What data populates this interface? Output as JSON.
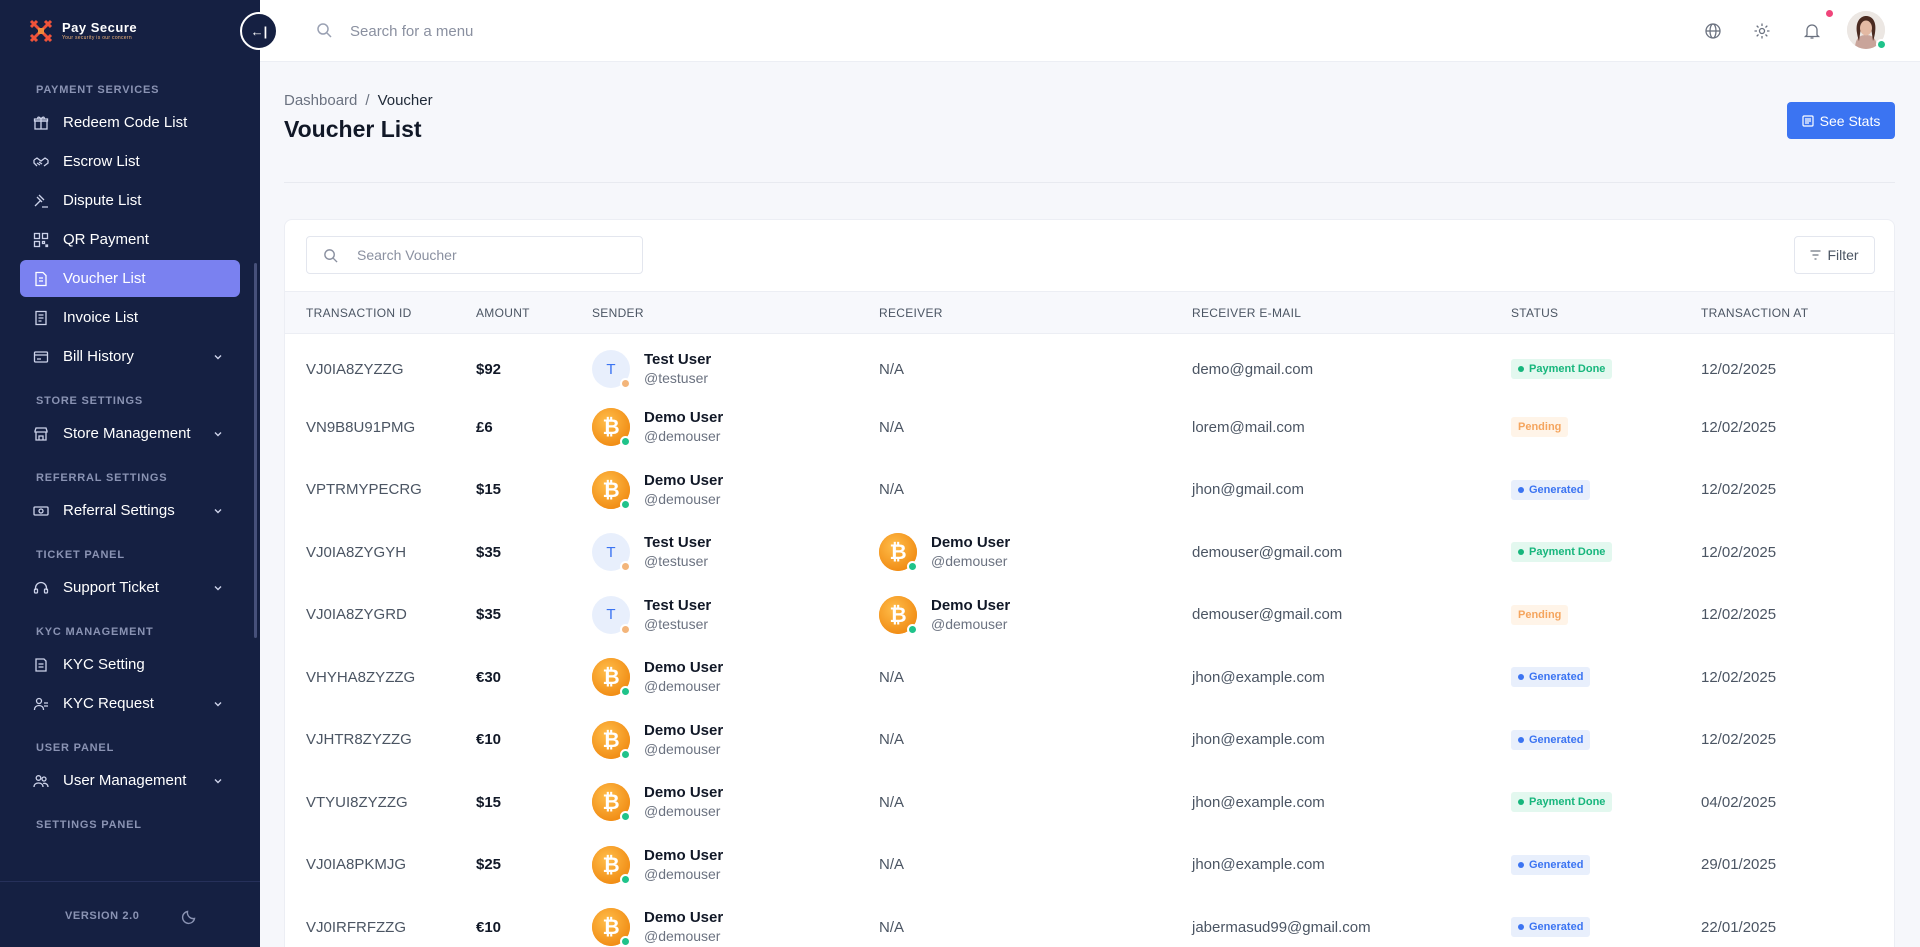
{
  "brand": {
    "name": "Pay Secure",
    "tagline": "Your security is our concern"
  },
  "sidebar": {
    "sections": [
      {
        "title": "PAYMENT SERVICES",
        "items": [
          {
            "label": "Redeem Code List",
            "icon": "gift-icon",
            "chevron": false,
            "active": false
          },
          {
            "label": "Escrow List",
            "icon": "handshake-icon",
            "chevron": false,
            "active": false
          },
          {
            "label": "Dispute List",
            "icon": "gavel-icon",
            "chevron": false,
            "active": false
          },
          {
            "label": "QR Payment",
            "icon": "qr-icon",
            "chevron": false,
            "active": false
          },
          {
            "label": "Voucher List",
            "icon": "voucher-icon",
            "chevron": false,
            "active": true
          },
          {
            "label": "Invoice List",
            "icon": "invoice-icon",
            "chevron": false,
            "active": false
          },
          {
            "label": "Bill History",
            "icon": "bill-icon",
            "chevron": true,
            "active": false
          }
        ]
      },
      {
        "title": "STORE SETTINGS",
        "items": [
          {
            "label": "Store Management",
            "icon": "store-icon",
            "chevron": true,
            "active": false
          }
        ]
      },
      {
        "title": "REFERRAL SETTINGS",
        "items": [
          {
            "label": "Referral Settings",
            "icon": "money-icon",
            "chevron": true,
            "active": false
          }
        ]
      },
      {
        "title": "TICKET PANEL",
        "items": [
          {
            "label": "Support Ticket",
            "icon": "headset-icon",
            "chevron": true,
            "active": false
          }
        ]
      },
      {
        "title": "KYC MANAGEMENT",
        "items": [
          {
            "label": "KYC Setting",
            "icon": "document-icon",
            "chevron": false,
            "active": false
          },
          {
            "label": "KYC Request",
            "icon": "user-check-icon",
            "chevron": true,
            "active": false
          }
        ]
      },
      {
        "title": "USER PANEL",
        "items": [
          {
            "label": "User Management",
            "icon": "users-icon",
            "chevron": true,
            "active": false
          }
        ]
      },
      {
        "title": "SETTINGS PANEL",
        "items": []
      }
    ],
    "version": "VERSION 2.0"
  },
  "topbar": {
    "search_placeholder": "Search for a menu"
  },
  "page": {
    "breadcrumb": {
      "root": "Dashboard",
      "separator": "/",
      "current": "Voucher"
    },
    "title": "Voucher List",
    "stats_button": "See Stats"
  },
  "table": {
    "search_placeholder": "Search Voucher",
    "filter_label": "Filter",
    "columns": [
      "TRANSACTION ID",
      "AMOUNT",
      "SENDER",
      "RECEIVER",
      "RECEIVER E-MAIL",
      "STATUS",
      "TRANSACTION AT"
    ],
    "rows": [
      {
        "id": "VJ0IA8ZYZZG",
        "amount": "$92",
        "sender": {
          "name": "Test User",
          "handle": "@testuser",
          "avatar": "T"
        },
        "receiver": null,
        "receiver_na": "N/A",
        "email": "demo@gmail.com",
        "status": "Payment Done",
        "date": "12/02/2025"
      },
      {
        "id": "VN9B8U91PMG",
        "amount": "£6",
        "sender": {
          "name": "Demo User",
          "handle": "@demouser",
          "avatar": "btc"
        },
        "receiver": null,
        "receiver_na": "N/A",
        "email": "lorem@mail.com",
        "status": "Pending",
        "date": "12/02/2025"
      },
      {
        "id": "VPTRMYPECRG",
        "amount": "$15",
        "sender": {
          "name": "Demo User",
          "handle": "@demouser",
          "avatar": "btc"
        },
        "receiver": null,
        "receiver_na": "N/A",
        "email": "jhon@gmail.com",
        "status": "Generated",
        "date": "12/02/2025"
      },
      {
        "id": "VJ0IA8ZYGYH",
        "amount": "$35",
        "sender": {
          "name": "Test User",
          "handle": "@testuser",
          "avatar": "T"
        },
        "receiver": {
          "name": "Demo User",
          "handle": "@demouser",
          "avatar": "btc"
        },
        "receiver_na": "",
        "email": "demouser@gmail.com",
        "status": "Payment Done",
        "date": "12/02/2025"
      },
      {
        "id": "VJ0IA8ZYGRD",
        "amount": "$35",
        "sender": {
          "name": "Test User",
          "handle": "@testuser",
          "avatar": "T"
        },
        "receiver": {
          "name": "Demo User",
          "handle": "@demouser",
          "avatar": "btc"
        },
        "receiver_na": "",
        "email": "demouser@gmail.com",
        "status": "Pending",
        "date": "12/02/2025"
      },
      {
        "id": "VHYHA8ZYZZG",
        "amount": "€30",
        "sender": {
          "name": "Demo User",
          "handle": "@demouser",
          "avatar": "btc"
        },
        "receiver": null,
        "receiver_na": "N/A",
        "email": "jhon@example.com",
        "status": "Generated",
        "date": "12/02/2025"
      },
      {
        "id": "VJHTR8ZYZZG",
        "amount": "€10",
        "sender": {
          "name": "Demo User",
          "handle": "@demouser",
          "avatar": "btc"
        },
        "receiver": null,
        "receiver_na": "N/A",
        "email": "jhon@example.com",
        "status": "Generated",
        "date": "12/02/2025"
      },
      {
        "id": "VTYUI8ZYZZG",
        "amount": "$15",
        "sender": {
          "name": "Demo User",
          "handle": "@demouser",
          "avatar": "btc"
        },
        "receiver": null,
        "receiver_na": "N/A",
        "email": "jhon@example.com",
        "status": "Payment Done",
        "date": "04/02/2025"
      },
      {
        "id": "VJ0IA8PKMJG",
        "amount": "$25",
        "sender": {
          "name": "Demo User",
          "handle": "@demouser",
          "avatar": "btc"
        },
        "receiver": null,
        "receiver_na": "N/A",
        "email": "jhon@example.com",
        "status": "Generated",
        "date": "29/01/2025"
      },
      {
        "id": "VJ0IRFRFZZG",
        "amount": "€10",
        "sender": {
          "name": "Demo User",
          "handle": "@demouser",
          "avatar": "btc"
        },
        "receiver": null,
        "receiver_na": "N/A",
        "email": "jabermasud99@gmail.com",
        "status": "Generated",
        "date": "22/01/2025"
      }
    ]
  },
  "colors": {
    "sidebar_bg": "#152042",
    "active_item": "#7a81f0",
    "primary": "#3b74f2",
    "status": {
      "Payment Done": {
        "bg": "#e3f8ef",
        "fg": "#16b67c"
      },
      "Pending": {
        "bg": "#fff4e8",
        "fg": "#f5a55e"
      },
      "Generated": {
        "bg": "#e8effc",
        "fg": "#3b74f2"
      }
    },
    "dot_online": "#1fc38a",
    "dot_away": "#f3b57a"
  }
}
